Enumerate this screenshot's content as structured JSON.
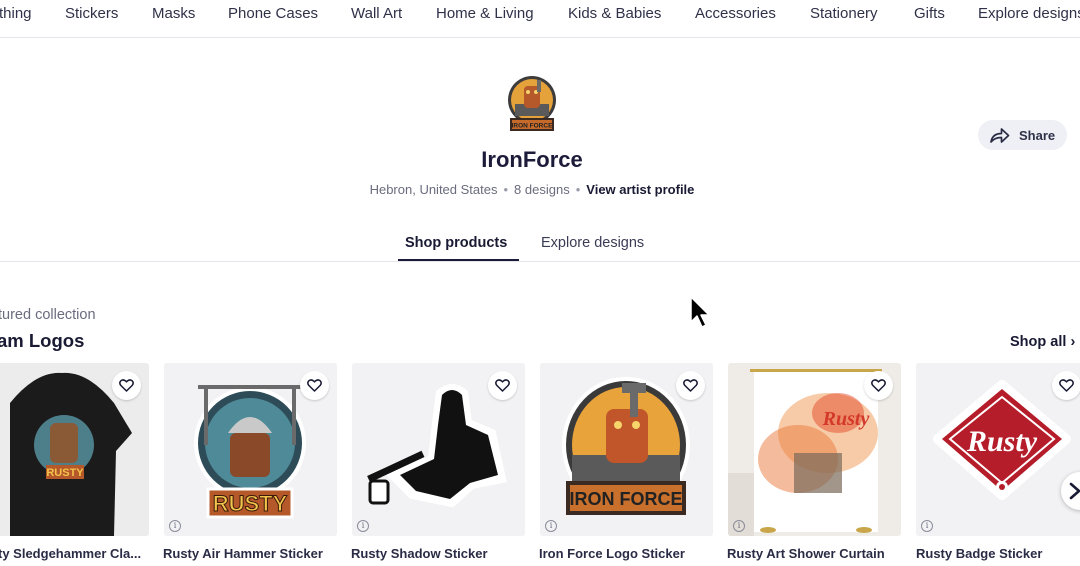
{
  "topnav": {
    "items": [
      "thing",
      "Stickers",
      "Masks",
      "Phone Cases",
      "Wall Art",
      "Home & Living",
      "Kids & Babies",
      "Accessories",
      "Stationery",
      "Gifts",
      "Explore designs"
    ]
  },
  "shop": {
    "name": "IronForce",
    "location": "Hebron, United States",
    "designs": "8 designs",
    "profile_link": "View artist profile",
    "logo_text": "IRON FORCE"
  },
  "share": {
    "label": "Share"
  },
  "tabs": [
    {
      "label": "Shop products",
      "active": true
    },
    {
      "label": "Explore designs",
      "active": false
    }
  ],
  "collection": {
    "eyebrow": "tured collection",
    "title": "am Logos",
    "shop_all": "Shop all"
  },
  "products": [
    {
      "title": "ty Sledgehammer Cla...",
      "art_text": "RUSTY"
    },
    {
      "title": "Rusty Air Hammer Sticker",
      "art_text": "RUSTY"
    },
    {
      "title": "Rusty Shadow Sticker"
    },
    {
      "title": "Iron Force Logo Sticker",
      "art_text": "IRON FORCE"
    },
    {
      "title": "Rusty Art Shower Curtain",
      "art_text": "Rusty"
    },
    {
      "title": "Rusty Badge Sticker",
      "art_text": "Rusty"
    }
  ],
  "icons": {
    "favorite": "heart-outline-icon",
    "info": "info-icon",
    "share": "share-arrow-icon",
    "next": "chevron-right-icon"
  },
  "colors": {
    "brand_text": "#1c1b3a",
    "badge_red": "#b51d2a",
    "rust": "#b5582a"
  }
}
